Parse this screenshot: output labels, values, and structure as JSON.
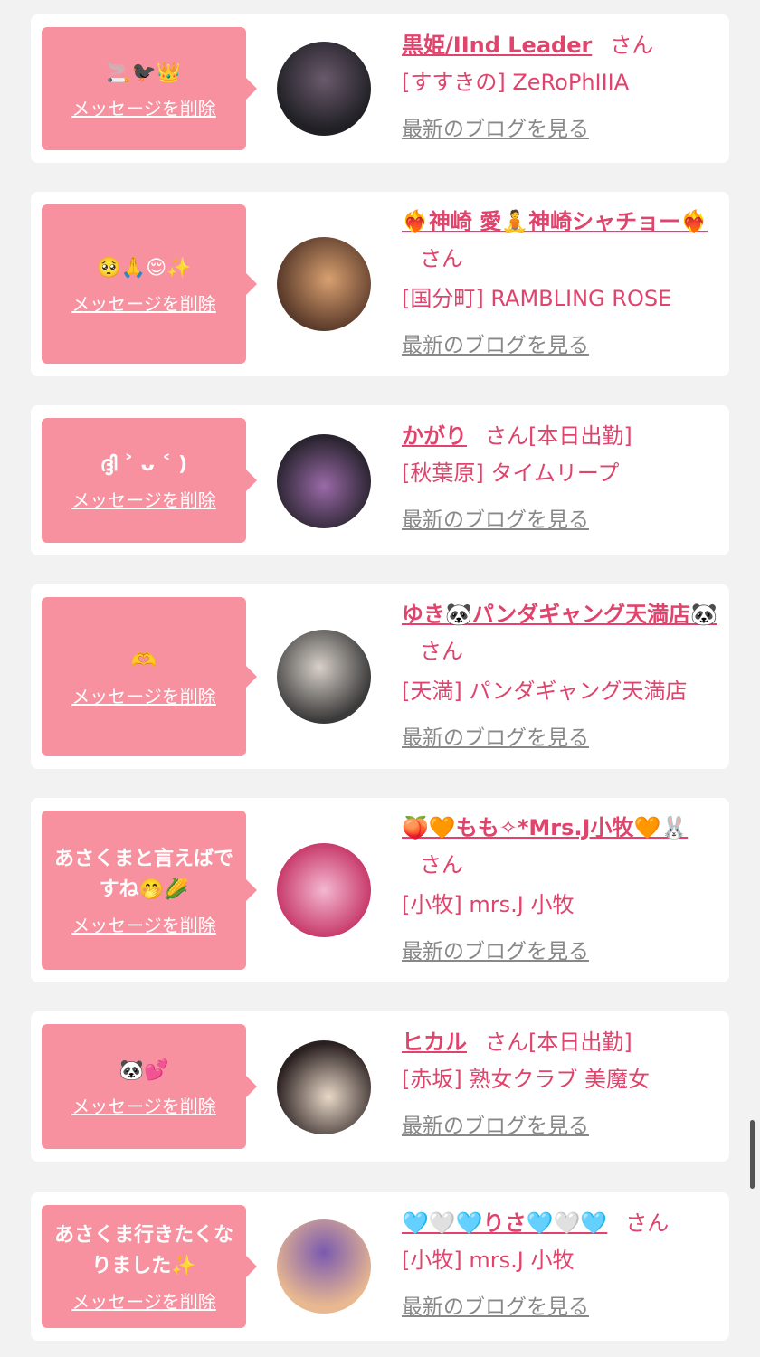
{
  "cards": [
    {
      "message": "🚬🐦‍⬛👑",
      "delete_label": "メッセージを削除",
      "name": "黒姫/IInd Leader",
      "suffix": "さん",
      "tag": "",
      "shop": "[すすきの] ZeRoPhIIIA",
      "blog_label": "最新のブログを見る",
      "avatar_colors": [
        "#1f1f24",
        "#6a5a6c"
      ]
    },
    {
      "message": "🥺🙏😌✨",
      "delete_label": "メッセージを削除",
      "name": "❤️‍🔥神崎 愛🧘神崎シャチョー❤️‍🔥",
      "suffix": "さん",
      "tag": "",
      "shop": "[国分町] RAMBLING ROSE",
      "blog_label": "最新のブログを見る",
      "avatar_colors": [
        "#5a3a2a",
        "#d8a070"
      ]
    },
    {
      "message": "ദ്ദി ˃ ᴗ ˂ )",
      "delete_label": "メッセージを削除",
      "name": "かがり",
      "suffix": "さん",
      "tag": "[本日出勤]",
      "shop": "[秋葉原] タイムリープ",
      "blog_label": "最新のブログを見る",
      "avatar_colors": [
        "#2a2430",
        "#9a6aa8"
      ]
    },
    {
      "message": "🫶",
      "delete_label": "メッセージを削除",
      "name": "ゆき🐼パンダギャング天満店🐼",
      "suffix": "さん",
      "tag": "",
      "shop": "[天満] パンダギャング天満店",
      "blog_label": "最新のブログを見る",
      "avatar_colors": [
        "#3a3a3a",
        "#d8d0c8"
      ]
    },
    {
      "message": "あさくまと言えばですね🤭🌽",
      "delete_label": "メッセージを削除",
      "name": "🍑🧡もも✧*Mrs.J小牧🧡🐰",
      "suffix": "さん",
      "tag": "",
      "shop": "[小牧] mrs.J 小牧",
      "blog_label": "最新のブログを見る",
      "avatar_colors": [
        "#c83c6c",
        "#f4b8d0"
      ]
    },
    {
      "message": "🐼💕",
      "delete_label": "メッセージを削除",
      "name": "ヒカル",
      "suffix": "さん",
      "tag": "[本日出勤]",
      "shop": "[赤坂] 熟女クラブ 美魔女",
      "blog_label": "最新のブログを見る",
      "avatar_colors": [
        "#2a2020",
        "#e8d8c8"
      ]
    },
    {
      "message": "あさくま行きたくなりました✨",
      "delete_label": "メッセージを削除",
      "name": "🩵🤍🩵りさ🩵🤍🩵",
      "suffix": "さん",
      "tag": "",
      "shop": "[小牧] mrs.J 小牧",
      "blog_label": "最新のブログを見る",
      "avatar_colors": [
        "#7a5ab0",
        "#e8b890"
      ]
    }
  ],
  "colors": {
    "bubble": "#f8919f",
    "accent": "#e0436b",
    "link_gray": "#888888",
    "background": "#f2f2f2"
  }
}
